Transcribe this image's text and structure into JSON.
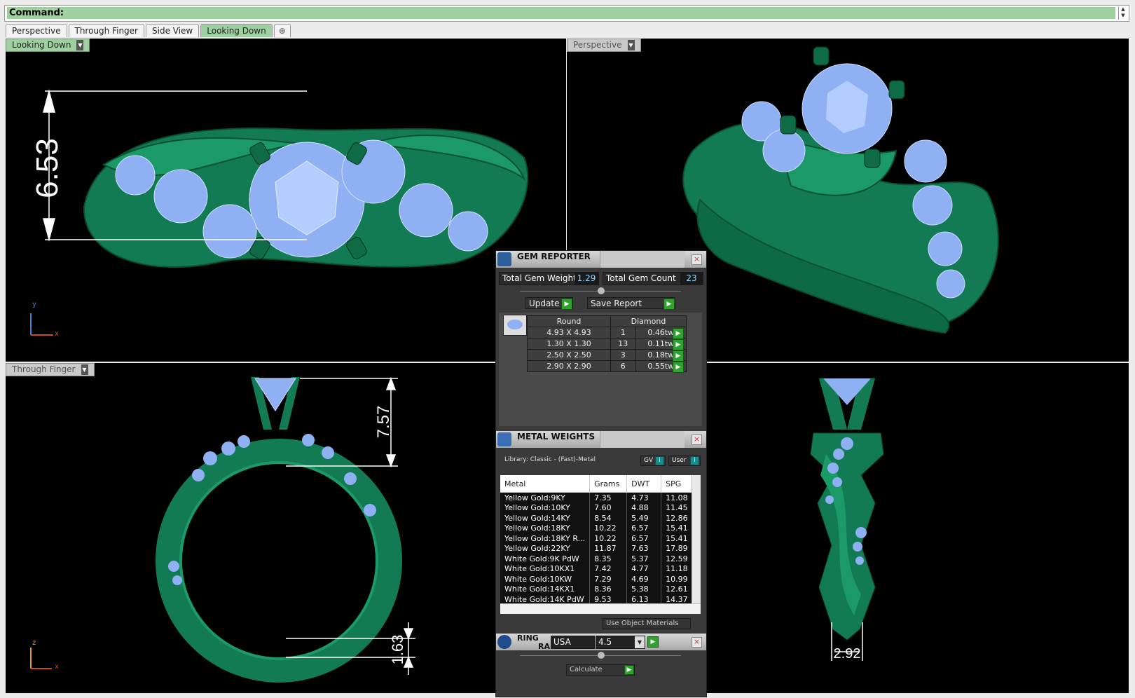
{
  "command": {
    "label": "Command:"
  },
  "tabs": [
    {
      "label": "Perspective"
    },
    {
      "label": "Through Finger"
    },
    {
      "label": "Side View"
    },
    {
      "label": "Looking Down"
    },
    {
      "label": "⊕"
    }
  ],
  "viewports": {
    "top_left": {
      "label": "Looking Down",
      "dimension": "6.53",
      "axis_v": "y",
      "axis_h": "x"
    },
    "top_right": {
      "label": "Perspective"
    },
    "bottom_left": {
      "label": "Through Finger",
      "dimension_a": "7.57",
      "dimension_b": "1.63",
      "axis_v": "z",
      "axis_h": "x"
    },
    "bottom_right": {
      "dimension": "2.92"
    }
  },
  "gem_reporter": {
    "title": "GEM REPORTER",
    "total_weight_label": "Total Gem Weight",
    "total_weight_value": "1.29",
    "total_count_label": "Total Gem Count",
    "total_count_value": "23",
    "update_label": "Update",
    "save_label": "Save Report",
    "header_shape": "Round",
    "header_type": "Diamond",
    "rows": [
      {
        "size": "4.93 X 4.93",
        "count": "1",
        "weight": "0.46tw"
      },
      {
        "size": "1.30 X 1.30",
        "count": "13",
        "weight": "0.11tw"
      },
      {
        "size": "2.50 X 2.50",
        "count": "3",
        "weight": "0.18tw"
      },
      {
        "size": "2.90 X 2.90",
        "count": "6",
        "weight": "0.55tw"
      }
    ]
  },
  "metal_weights": {
    "title": "METAL WEIGHTS",
    "library": "Library: Classic - (Fast)-Metal",
    "gv_label": "GV",
    "user_label": "User",
    "columns": [
      "Metal",
      "Grams",
      "DWT",
      "SPG"
    ],
    "rows": [
      {
        "metal": "Yellow Gold:9KY",
        "grams": "7.35",
        "dwt": "4.73",
        "spg": "11.08"
      },
      {
        "metal": "Yellow Gold:10KY",
        "grams": "7.60",
        "dwt": "4.88",
        "spg": "11.45"
      },
      {
        "metal": "Yellow Gold:14KY",
        "grams": "8.54",
        "dwt": "5.49",
        "spg": "12.86"
      },
      {
        "metal": "Yellow Gold:18KY",
        "grams": "10.22",
        "dwt": "6.57",
        "spg": "15.41"
      },
      {
        "metal": "Yellow Gold:18KY R...",
        "grams": "10.22",
        "dwt": "6.57",
        "spg": "15.41"
      },
      {
        "metal": "Yellow Gold:22KY",
        "grams": "11.87",
        "dwt": "7.63",
        "spg": "17.89"
      },
      {
        "metal": "White Gold:9K PdW",
        "grams": "8.35",
        "dwt": "5.37",
        "spg": "12.59"
      },
      {
        "metal": "White Gold:10KX1",
        "grams": "7.42",
        "dwt": "4.77",
        "spg": "11.18"
      },
      {
        "metal": "White Gold:10KW",
        "grams": "7.29",
        "dwt": "4.69",
        "spg": "10.99"
      },
      {
        "metal": "White Gold:14KX1",
        "grams": "8.36",
        "dwt": "5.38",
        "spg": "12.61"
      },
      {
        "metal": "White Gold:14K PdW",
        "grams": "9.53",
        "dwt": "6.13",
        "spg": "14.37"
      }
    ],
    "use_object_materials": "Use Object Materials"
  },
  "ring_rail": {
    "title_line1": "RING",
    "title_line2": "RAIL",
    "region": "USA",
    "size": "4.5",
    "calculate_label": "Calculate"
  },
  "colors": {
    "ring_green": "#127a52",
    "gem_blue": "#8fb0f2",
    "accent_green": "#9fd09f"
  }
}
